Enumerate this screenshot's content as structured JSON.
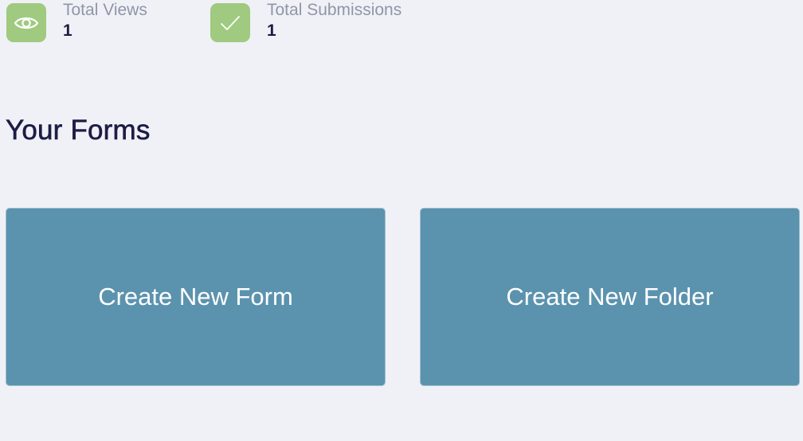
{
  "colors": {
    "background": "#f0f1f6",
    "stat_icon_bg": "#9fca7f",
    "card_bg": "#5b93ae",
    "heading": "#1c1d45",
    "label": "#8e96a8"
  },
  "stats": {
    "views": {
      "icon": "eye-icon",
      "label": "Total Views",
      "value": "1"
    },
    "submissions": {
      "icon": "checkmark-icon",
      "label": "Total Submissions",
      "value": "1"
    }
  },
  "forms_section": {
    "title": "Your Forms",
    "actions": [
      {
        "label": "Create New Form"
      },
      {
        "label": "Create New Folder"
      }
    ]
  }
}
